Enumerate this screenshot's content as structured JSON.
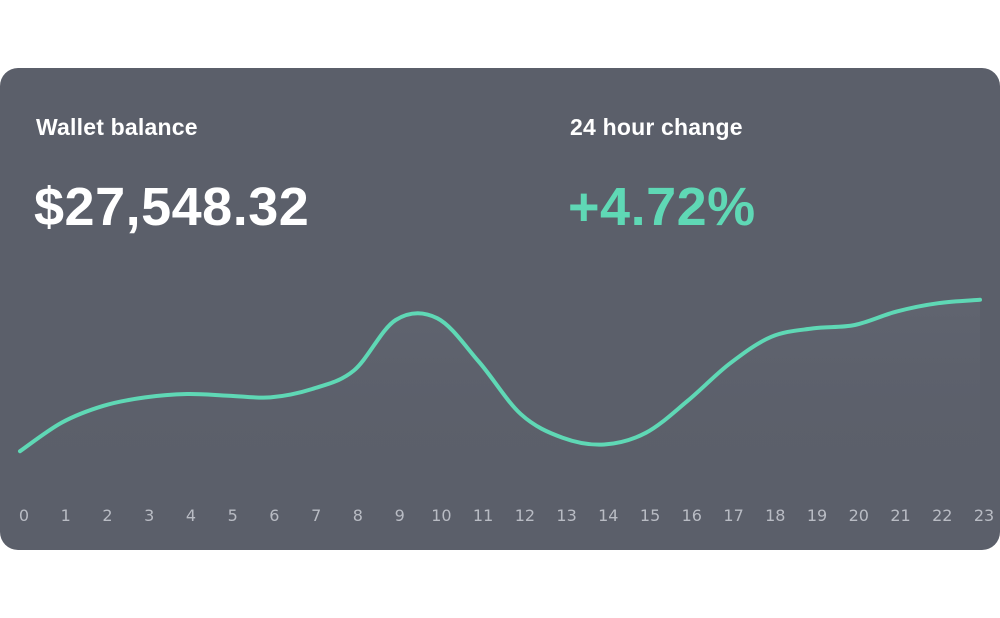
{
  "header": {
    "balance_label": "Wallet balance",
    "balance_value": "$27,548.32",
    "change_label": "24 hour change",
    "change_value": "+4.72%"
  },
  "colors": {
    "card_background": "#5b5f6a",
    "line": "#5fd8b5",
    "positive_change": "#5fd8b5",
    "tick_label": "#b9bcc4"
  },
  "chart_data": {
    "type": "line",
    "title": "",
    "xlabel": "",
    "ylabel": "",
    "grid": false,
    "x": [
      0,
      1,
      2,
      3,
      4,
      5,
      6,
      7,
      8,
      9,
      10,
      11,
      12,
      13,
      14,
      15,
      16,
      17,
      18,
      19,
      20,
      21,
      22,
      23
    ],
    "tick_labels": [
      "0",
      "1",
      "2",
      "3",
      "4",
      "5",
      "6",
      "7",
      "8",
      "9",
      "10",
      "11",
      "12",
      "13",
      "14",
      "15",
      "16",
      "17",
      "18",
      "19",
      "20",
      "21",
      "22",
      "23"
    ],
    "series": [
      {
        "values": [
          10,
          27,
          37,
          42,
          44,
          43,
          42,
          47,
          58,
          88,
          89,
          63,
          32,
          18,
          14,
          21,
          40,
          62,
          78,
          83,
          85,
          93,
          98,
          100
        ]
      }
    ],
    "ylim": [
      0,
      110
    ]
  }
}
